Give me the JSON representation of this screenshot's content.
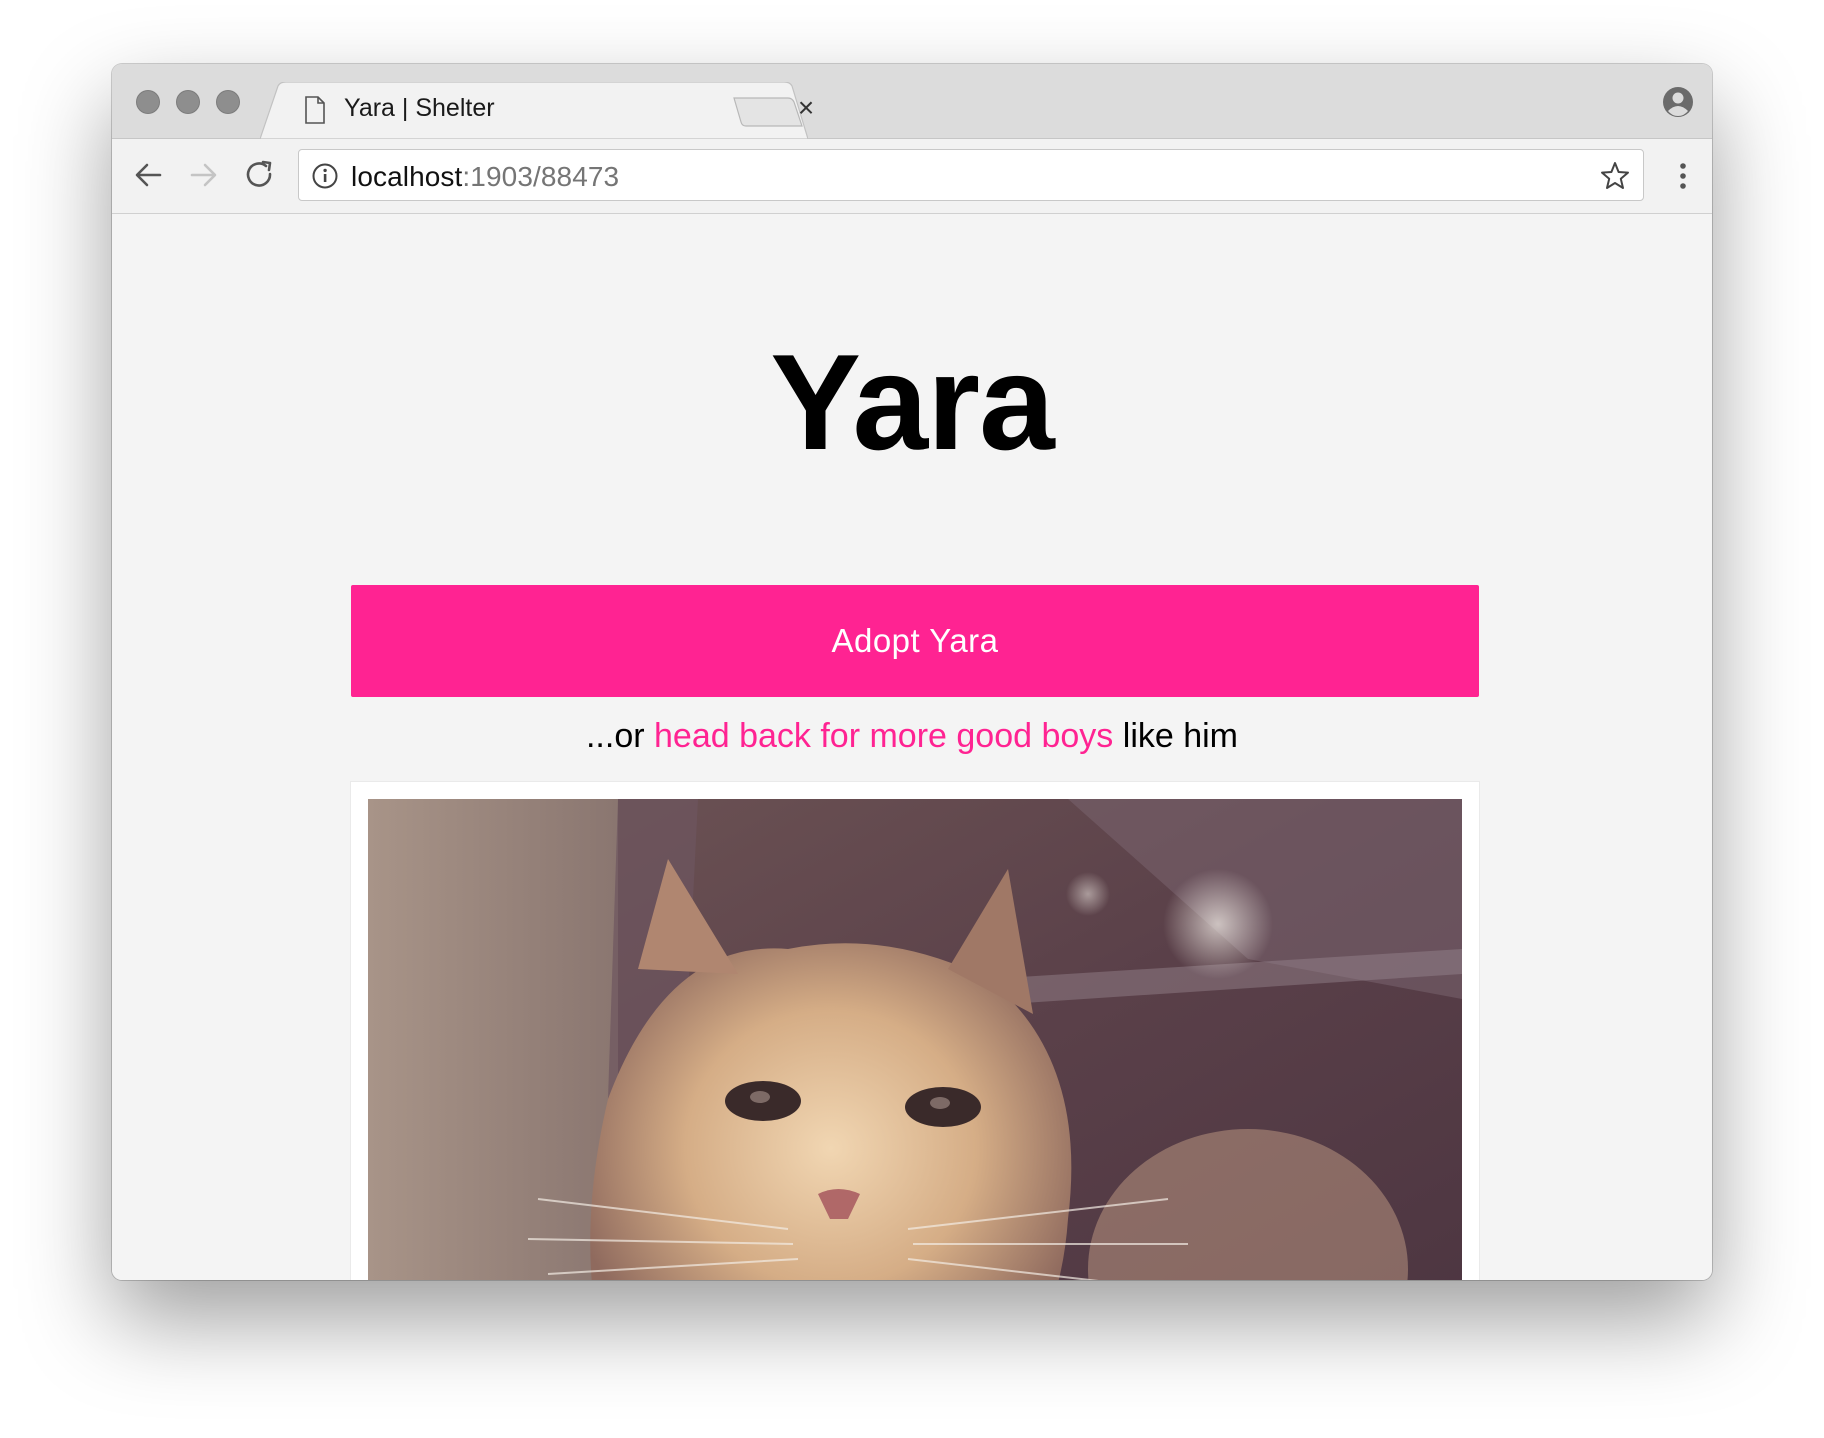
{
  "browser": {
    "tab_title": "Yara | Shelter",
    "tab_close": "×",
    "url_host": "localhost",
    "url_rest": ":1903/88473"
  },
  "icons": {
    "tab": "document-icon",
    "back": "arrow-left-icon",
    "forward": "arrow-right-icon",
    "reload": "reload-icon",
    "info": "info-icon",
    "bookmark": "star-icon",
    "menu": "kebab-menu-icon",
    "profile": "profile-icon"
  },
  "page": {
    "title": "Yara",
    "adopt_label": "Adopt Yara",
    "subline_prefix": "...or ",
    "subline_link": "head back for more good boys",
    "subline_suffix": " like him"
  },
  "colors": {
    "accent": "#ff2392",
    "page_bg": "#f4f4f4"
  }
}
